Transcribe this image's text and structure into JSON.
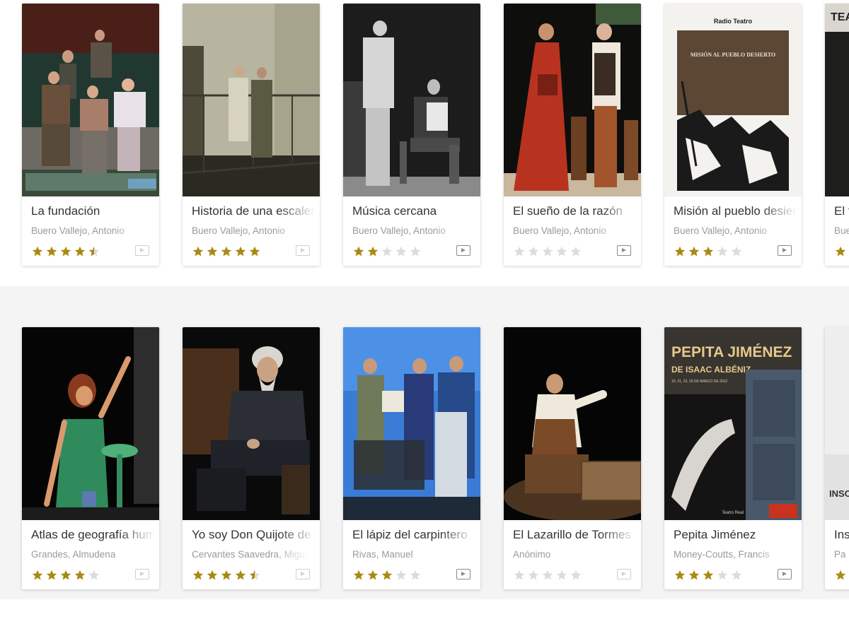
{
  "colors": {
    "star_filled": "#a98a13",
    "star_empty": "#dcdcdc",
    "row_alt_background": "#f4f4f5"
  },
  "rows": [
    {
      "items": [
        {
          "title": "La fundación",
          "author": "Buero Vallejo, Antonio",
          "rating": 4.5,
          "play_icon": "play-icon",
          "play_active": false
        },
        {
          "title": "Historia de una escalera",
          "author": "Buero Vallejo, Antonio",
          "rating": 5,
          "play_icon": "play-icon",
          "play_active": false
        },
        {
          "title": "Música cercana",
          "author": "Buero Vallejo, Antonio",
          "rating": 2,
          "play_icon": "play-icon",
          "play_active": true
        },
        {
          "title": "El sueño de la razón",
          "author": "Buero Vallejo, Antonio",
          "rating": 0,
          "play_icon": "play-icon",
          "play_active": true
        },
        {
          "title": "Misión al pueblo desierto",
          "author": "Buero Vallejo, Antonio",
          "rating": 3,
          "play_icon": "play-icon",
          "play_active": true
        },
        {
          "title": "El t",
          "author": "Bue",
          "rating": 1,
          "play_icon": "play-icon",
          "play_active": false
        }
      ]
    },
    {
      "items": [
        {
          "title": "Atlas de geografía humana",
          "author": "Grandes, Almudena",
          "rating": 4,
          "play_icon": "play-icon",
          "play_active": false
        },
        {
          "title": "Yo soy Don Quijote de la Mancha",
          "author": "Cervantes Saavedra, Miguel de",
          "rating": 4.5,
          "play_icon": "play-icon",
          "play_active": false
        },
        {
          "title": "El lápiz del carpintero",
          "author": "Rivas, Manuel",
          "rating": 3,
          "play_icon": "play-icon",
          "play_active": true
        },
        {
          "title": "El Lazarillo de Tormes",
          "author": "Anónimo",
          "rating": 0,
          "play_icon": "play-icon",
          "play_active": false
        },
        {
          "title": "Pepita Jiménez",
          "author": "Money-Coutts, Francis",
          "rating": 3,
          "play_icon": "play-icon",
          "play_active": true
        },
        {
          "title": "Ins",
          "author": "Pa",
          "rating": 1,
          "play_icon": "play-icon",
          "play_active": false
        }
      ]
    }
  ],
  "poster_text": {
    "mision_header": "Radio Teatro",
    "mision_title": "MISIÓN AL PUEBLO DESIERTO",
    "pepita_title": "PEPITA JIMÉNEZ",
    "pepita_subtitle": "DE ISAAC ALBÉNIZ",
    "pepita_dates": "19, 21, 23, 25 DE MARZO DE 2012",
    "pepita_logo": "Teatro Real",
    "partial_poster_top": "TEA",
    "partial_poster_bottom": "INSO"
  }
}
